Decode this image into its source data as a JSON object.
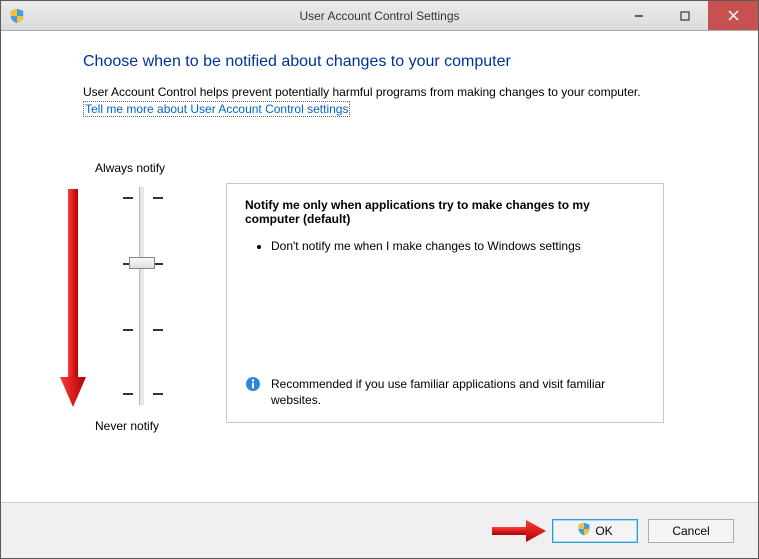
{
  "window": {
    "title": "User Account Control Settings"
  },
  "heading": "Choose when to be notified about changes to your computer",
  "description": "User Account Control helps prevent potentially harmful programs from making changes to your computer.",
  "help_link": "Tell me more about User Account Control settings",
  "slider": {
    "top_label": "Always notify",
    "bottom_label": "Never notify",
    "levels": 4,
    "selected_index": 1
  },
  "panel": {
    "title": "Notify me only when applications try to make changes to my computer (default)",
    "bullets": [
      "Don't notify me when I make changes to Windows settings"
    ],
    "recommendation": "Recommended if you use familiar applications and visit familiar websites."
  },
  "buttons": {
    "ok": "OK",
    "cancel": "Cancel"
  },
  "annotations": {
    "arrow_color": "#d40000"
  }
}
